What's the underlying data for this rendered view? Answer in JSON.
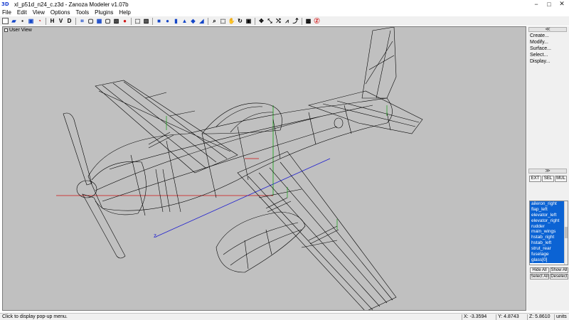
{
  "app": {
    "logo_text": "3D",
    "title": "xl_p51d_n24_c.z3d - Zanoza Modeler v1.07b"
  },
  "window_controls": {
    "minimize": "−",
    "maximize": "□",
    "close": "✕"
  },
  "menu": [
    "File",
    "Edit",
    "View",
    "Options",
    "Tools",
    "Plugins",
    "Help"
  ],
  "toolbar": {
    "letters": [
      "H",
      "V",
      "D"
    ]
  },
  "viewport": {
    "label": "User View",
    "axis_z": "z",
    "background": "#c0c0c0",
    "wire_color": "#000000",
    "axis_colors": {
      "x": "#d01010",
      "y": "#10a010",
      "z": "#1d1dcf"
    }
  },
  "right_panel": {
    "toggle_up": "≪",
    "toggle_down": "≫",
    "commands": [
      "Create...",
      "Modify...",
      "Surface...",
      "Select...",
      "Display..."
    ],
    "modes": [
      "EXT",
      "SEL",
      "MUL"
    ],
    "objects": [
      "aileron_right",
      "flap_left",
      "elevator_left",
      "elevator_right",
      "rudder",
      "main_wings",
      "hstab_right",
      "hstab_left",
      "strut_rear",
      "fuselage",
      "glass[0]"
    ],
    "buttons": {
      "hide_all": "Hide All",
      "show_all": "Show All",
      "select_all": "Select All",
      "deselect": "Deselect"
    },
    "selection_color": "#0b63d4"
  },
  "status": {
    "message": "Click to display pop-up menu.",
    "x": "X: -3.3594",
    "y": "Y: 4.8743",
    "z": "Z: 5.8610",
    "units": "units"
  }
}
